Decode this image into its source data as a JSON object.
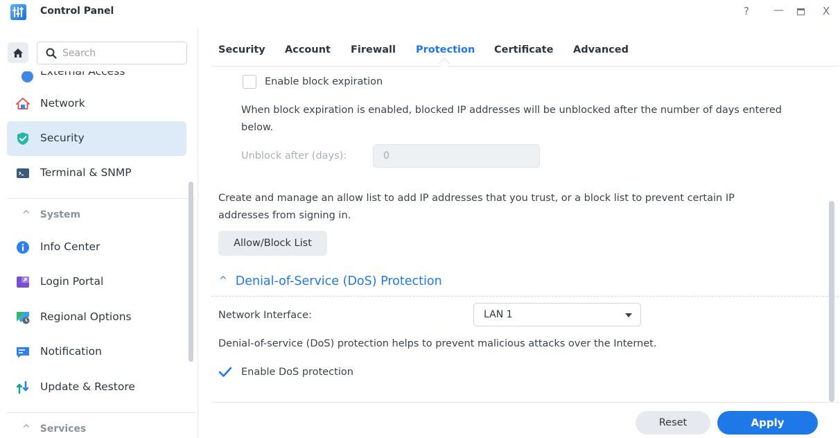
{
  "window": {
    "title": "Control Panel",
    "help": "?",
    "minimize": "—",
    "close": "X"
  },
  "sidebar": {
    "search_placeholder": "Search",
    "partial_item": "External Access",
    "items": [
      {
        "label": "Network",
        "icon": "network-house-icon"
      },
      {
        "label": "Security",
        "icon": "shield-check-icon",
        "active": true
      },
      {
        "label": "Terminal & SNMP",
        "icon": "terminal-icon"
      }
    ],
    "system_header": "System",
    "system_items": [
      {
        "label": "Info Center",
        "icon": "info-icon"
      },
      {
        "label": "Login Portal",
        "icon": "login-portal-icon"
      },
      {
        "label": "Regional Options",
        "icon": "regional-options-icon"
      },
      {
        "label": "Notification",
        "icon": "notification-icon"
      },
      {
        "label": "Update & Restore",
        "icon": "update-restore-icon"
      }
    ],
    "services_header": "Services",
    "chevron": "^"
  },
  "tabs": [
    {
      "label": "Security"
    },
    {
      "label": "Account"
    },
    {
      "label": "Firewall"
    },
    {
      "label": "Protection",
      "active": true
    },
    {
      "label": "Certificate"
    },
    {
      "label": "Advanced"
    }
  ],
  "content": {
    "block_expiration_label": "Enable block expiration",
    "block_expiration_checked": false,
    "block_expiration_desc_1": "When block expiration is enabled, blocked IP addresses will be unblocked after the number of days entered",
    "block_expiration_desc_2": "below.",
    "unblock_label": "Unblock after (days):",
    "unblock_value": "0",
    "allow_list_desc_1": "Create and manage an allow list to add IP addresses that you trust, or a block list to prevent certain IP",
    "allow_list_desc_2": "addresses from signing in.",
    "allow_block_button": "Allow/Block List",
    "dos_header": "Denial-of-Service (DoS) Protection",
    "dos_chevron": "^",
    "network_interface_label": "Network Interface:",
    "network_interface_value": "LAN 1",
    "dos_desc": "Denial-of-service (DoS) protection helps to prevent malicious attacks over the Internet.",
    "dos_enable_label": "Enable DoS protection",
    "dos_enable_checked": true
  },
  "footer": {
    "reset": "Reset",
    "apply": "Apply"
  },
  "colors": {
    "accent": "#1e78e8",
    "active_nav_bg": "#ddeaf8"
  }
}
